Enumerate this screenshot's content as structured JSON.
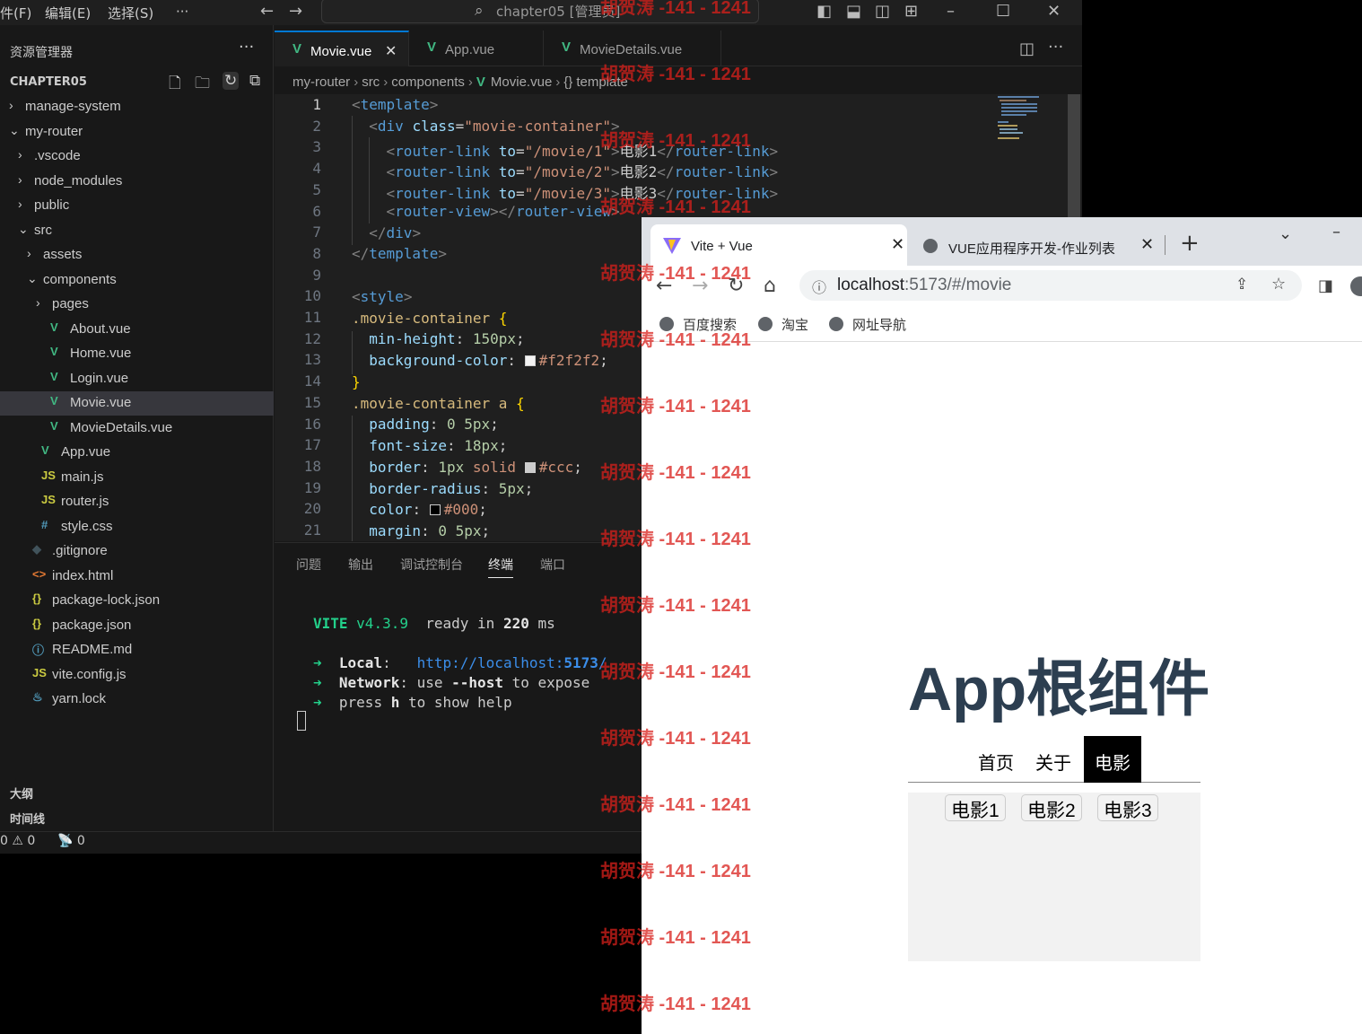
{
  "vscode": {
    "menu": [
      "件(F)",
      "编辑(E)",
      "选择(S)",
      "···"
    ],
    "command_center": "chapter05 [管理员]",
    "explorer_title": "资源管理器",
    "project": "CHAPTER05",
    "tree": [
      {
        "label": "manage-system",
        "kind": "folder",
        "open": false
      },
      {
        "label": "my-router",
        "kind": "folder",
        "open": true
      },
      {
        "label": ".vscode",
        "kind": "folder",
        "open": false
      },
      {
        "label": "node_modules",
        "kind": "folder",
        "open": false
      },
      {
        "label": "public",
        "kind": "folder",
        "open": false
      },
      {
        "label": "src",
        "kind": "folder",
        "open": true
      },
      {
        "label": "assets",
        "kind": "folder",
        "open": false
      },
      {
        "label": "components",
        "kind": "folder",
        "open": true
      },
      {
        "label": "pages",
        "kind": "folder",
        "open": false
      },
      {
        "label": "About.vue",
        "kind": "vue"
      },
      {
        "label": "Home.vue",
        "kind": "vue"
      },
      {
        "label": "Login.vue",
        "kind": "vue"
      },
      {
        "label": "Movie.vue",
        "kind": "vue",
        "active": true
      },
      {
        "label": "MovieDetails.vue",
        "kind": "vue"
      },
      {
        "label": "App.vue",
        "kind": "vue"
      },
      {
        "label": "main.js",
        "kind": "js"
      },
      {
        "label": "router.js",
        "kind": "js"
      },
      {
        "label": "style.css",
        "kind": "css"
      },
      {
        "label": ".gitignore",
        "kind": "git"
      },
      {
        "label": "index.html",
        "kind": "html"
      },
      {
        "label": "package-lock.json",
        "kind": "json"
      },
      {
        "label": "package.json",
        "kind": "json"
      },
      {
        "label": "README.md",
        "kind": "info"
      },
      {
        "label": "vite.config.js",
        "kind": "js"
      },
      {
        "label": "yarn.lock",
        "kind": "yarn"
      }
    ],
    "sections": [
      "大纲",
      "时间线"
    ],
    "status": {
      "errors": "0",
      "warnings": "0",
      "ports": "0"
    },
    "tabs": [
      {
        "label": "Movie.vue",
        "active": true
      },
      {
        "label": "App.vue"
      },
      {
        "label": "MovieDetails.vue"
      }
    ],
    "breadcrumb": [
      "my-router",
      "src",
      "components",
      "Movie.vue",
      "template"
    ],
    "line_numbers": [
      "1",
      "2",
      "3",
      "4",
      "5",
      "6",
      "7",
      "8",
      "9",
      "10",
      "11",
      "12",
      "13",
      "14",
      "15",
      "16",
      "17",
      "18",
      "19",
      "20",
      "21"
    ],
    "code": {
      "l1_tag": "template",
      "l2_tag": "div",
      "l2_attr": "class",
      "l2_val": "\"movie-container\"",
      "link_tag": "router-link",
      "link_attr": "to",
      "l3_val": "\"/movie/1\"",
      "l3_text": "电影1",
      "l4_val": "\"/movie/2\"",
      "l4_text": "电影2",
      "l5_val": "\"/movie/3\"",
      "l5_text": "电影3",
      "l6_tag": "router-view",
      "l7_tag": "div",
      "l8_tag": "template",
      "l10_tag": "style",
      "l11_sel": ".movie-container",
      "l12_prop": "min-height",
      "l12_val": "150px",
      "l13_prop": "background-color",
      "l13_val": "#f2f2f2",
      "l15_sel": ".movie-container a",
      "l16_prop": "padding",
      "l16_val": "0 5px",
      "l17_prop": "font-size",
      "l17_val": "18px",
      "l18_prop": "border",
      "l18_num": "1px",
      "l18_kw": "solid",
      "l18_val": "#ccc",
      "l19_prop": "border-radius",
      "l19_val": "5px",
      "l20_prop": "color",
      "l20_val": "#000",
      "l21_prop": "margin",
      "l21_val": "0 5px"
    },
    "panel_tabs": [
      "问题",
      "输出",
      "调试控制台",
      "终端",
      "端口"
    ],
    "terminal": {
      "vite": "VITE",
      "version": "v4.3.9",
      "ready": "ready in",
      "ready_ms": "220",
      "ms": "ms",
      "arrow": "➜",
      "local_label": "Local",
      "local_url_a": "http://localhost:",
      "local_url_port": "5173",
      "local_url_b": "/",
      "network_label": "Network",
      "network_a": "use",
      "network_flag": "--host",
      "network_b": "to expose",
      "press_a": "press",
      "press_key": "h",
      "press_b": "to show help"
    }
  },
  "browser": {
    "tabs": [
      {
        "label": "Vite + Vue",
        "active": true
      },
      {
        "label": "VUE应用程序开发-作业列表"
      }
    ],
    "url_host": "localhost",
    "url_rest": ":5173/#/movie",
    "bookmarks": [
      "百度搜索",
      "淘宝",
      "网址导航"
    ],
    "page": {
      "title": "App根组件",
      "nav": [
        {
          "label": "首页"
        },
        {
          "label": "关于"
        },
        {
          "label": "电影",
          "active": true
        }
      ],
      "movies": [
        "电影1",
        "电影2",
        "电影3"
      ]
    }
  },
  "watermark": "胡贺涛 -141 - 1241",
  "colors": {
    "vscode_bg": "#181818",
    "editor_bg": "#1f1f1f",
    "accent": "#0078d4",
    "vue_green": "#41b883",
    "title_color": "#2c3e50",
    "movie_bg": "#f2f2f2",
    "watermark": "#d9201b"
  }
}
